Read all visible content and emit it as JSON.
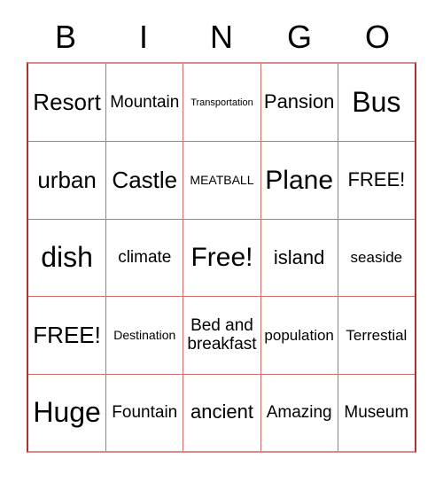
{
  "card": {
    "title": "BINGO",
    "columns": 5,
    "rows": 5,
    "grid_border_color": "#a8332f",
    "grid_line_color": "#cf6d6a",
    "text_color": "#000000",
    "background_color": "#ffffff"
  },
  "header": {
    "letters": [
      "B",
      "I",
      "N",
      "G",
      "O"
    ]
  },
  "rows": [
    {
      "cells": [
        {
          "text": "Resort",
          "size": "lg"
        },
        {
          "text": "Mountain",
          "size": "sm"
        },
        {
          "text": "Transportation",
          "size": "tiny"
        },
        {
          "text": "Pansion",
          "size": "md"
        },
        {
          "text": "Bus",
          "size": "xxl"
        }
      ]
    },
    {
      "cells": [
        {
          "text": "urban",
          "size": "lg"
        },
        {
          "text": "Castle",
          "size": "lg"
        },
        {
          "text": "MEATBALL",
          "size": "xxs"
        },
        {
          "text": "Plane",
          "size": "xl"
        },
        {
          "text": "FREE!",
          "size": "md"
        }
      ]
    },
    {
      "cells": [
        {
          "text": "dish",
          "size": "xxl"
        },
        {
          "text": "climate",
          "size": "sm"
        },
        {
          "text": "Free!",
          "size": "xl"
        },
        {
          "text": "island",
          "size": "md"
        },
        {
          "text": "seaside",
          "size": "xs"
        }
      ]
    },
    {
      "cells": [
        {
          "text": "FREE!",
          "size": "lg"
        },
        {
          "text": "Destination",
          "size": "xxs"
        },
        {
          "text": "Bed and\nbreakfast",
          "size": "sm"
        },
        {
          "text": "population",
          "size": "xs"
        },
        {
          "text": "Terrestial",
          "size": "xs"
        }
      ]
    },
    {
      "cells": [
        {
          "text": "Huge",
          "size": "xxl"
        },
        {
          "text": "Fountain",
          "size": "sm"
        },
        {
          "text": "ancient",
          "size": "md"
        },
        {
          "text": "Amazing",
          "size": "sm"
        },
        {
          "text": "Museum",
          "size": "sm"
        }
      ]
    }
  ]
}
